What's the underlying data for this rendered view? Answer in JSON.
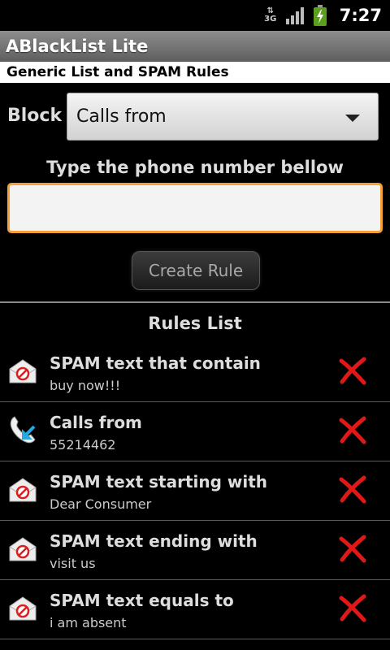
{
  "status_bar": {
    "network": "3G",
    "time": "7:27"
  },
  "app": {
    "title": "ABlackList Lite",
    "subtitle": "Generic List and SPAM Rules"
  },
  "form": {
    "block_label": "Block",
    "block_type": "Calls from",
    "prompt": "Type the phone number bellow",
    "phone_value": "",
    "create_label": "Create Rule"
  },
  "rules": {
    "header": "Rules List",
    "items": [
      {
        "icon": "spam-envelope-icon",
        "title": "SPAM text that contain",
        "value": "buy now!!!"
      },
      {
        "icon": "incoming-call-icon",
        "title": "Calls from",
        "value": "55214462"
      },
      {
        "icon": "spam-envelope-icon",
        "title": "SPAM text starting with",
        "value": "Dear Consumer"
      },
      {
        "icon": "spam-envelope-icon",
        "title": "SPAM text ending with",
        "value": "visit us"
      },
      {
        "icon": "spam-envelope-icon",
        "title": "SPAM text equals to",
        "value": "i am absent"
      }
    ]
  },
  "colors": {
    "accent_orange": "#f7a036",
    "delete_red": "#e01818",
    "call_arrow": "#29a8e0"
  }
}
